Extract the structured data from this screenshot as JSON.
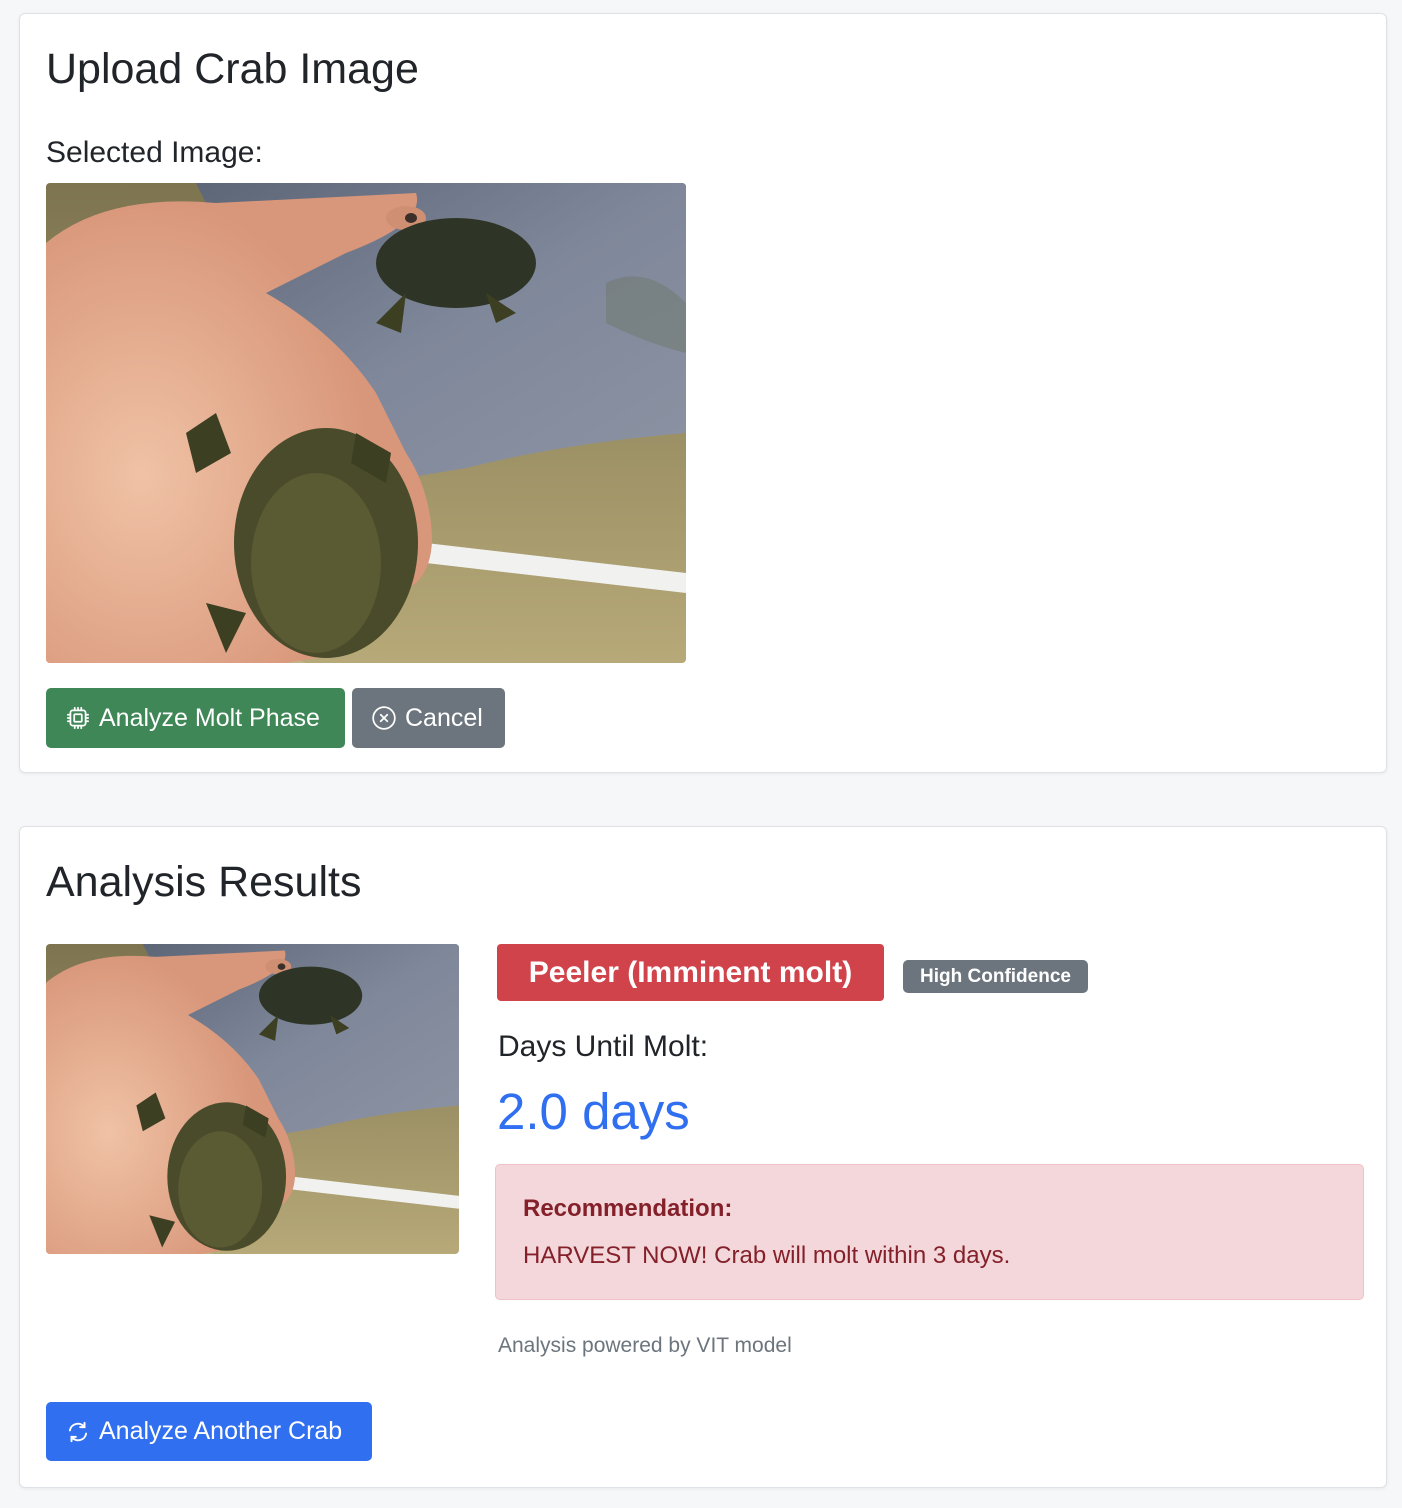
{
  "upload": {
    "title": "Upload Crab Image",
    "selected_label": "Selected Image:",
    "image_alt": "crab-photo",
    "analyze_button": "Analyze Molt Phase",
    "cancel_button": "Cancel"
  },
  "results": {
    "title": "Analysis Results",
    "phase": "Peeler (Imminent molt)",
    "confidence": "High Confidence",
    "days_label": "Days Until Molt:",
    "days_value": "2.0 days",
    "recommendation_title": "Recommendation:",
    "recommendation_text": "HARVEST NOW! Crab will molt within 3 days.",
    "footnote": "Analysis powered by VIT model",
    "another_button": "Analyze Another Crab"
  },
  "colors": {
    "analyze_button": "#3f8757",
    "cancel_button": "#6c757d",
    "phase_badge": "#d1434a",
    "confidence_badge": "#6c757d",
    "days_value": "#2f6ff0",
    "alert_bg": "#f3d7da",
    "alert_text": "#84202a",
    "primary_button": "#2f6ff0"
  },
  "icons": {
    "analyze": "cpu-icon",
    "cancel": "x-circle-icon",
    "another": "arrow-repeat-icon"
  }
}
